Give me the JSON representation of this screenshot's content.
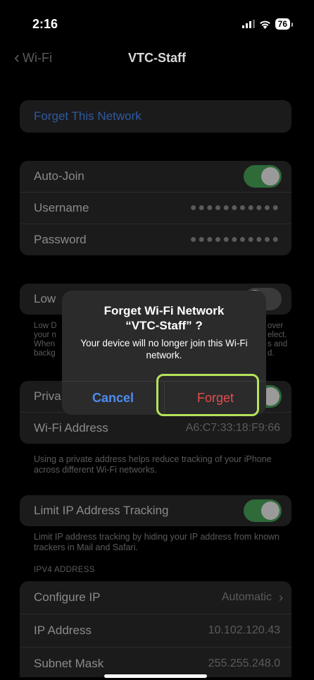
{
  "status": {
    "time": "2:16",
    "battery": "76"
  },
  "nav": {
    "back_label": "Wi-Fi",
    "title": "VTC-Staff"
  },
  "forget_row": "Forget This Network",
  "credentials": {
    "auto_join": "Auto-Join",
    "username_label": "Username",
    "username_value": "●●●●●●●●●●●",
    "password_label": "Password",
    "password_value": "●●●●●●●●●●●"
  },
  "low_data": {
    "label": "Low",
    "note_left": [
      "Low D",
      "your n",
      "When",
      "backg"
    ],
    "note_right": [
      "over",
      "elect.",
      "s and",
      "d."
    ]
  },
  "private": {
    "label": "Priva",
    "wifi_address_label": "Wi-Fi Address",
    "wifi_address_value": "A6:C7:33:18:F9:66",
    "note": "Using a private address helps reduce tracking of your iPhone across different Wi-Fi networks."
  },
  "limit_ip": {
    "label": "Limit IP Address Tracking",
    "note": "Limit IP address tracking by hiding your IP address from known trackers in Mail and Safari."
  },
  "ipv4": {
    "header": "IPV4 ADDRESS",
    "configure_label": "Configure IP",
    "configure_value": "Automatic",
    "ip_label": "IP Address",
    "ip_value": "10.102.120.43",
    "subnet_label": "Subnet Mask",
    "subnet_value": "255.255.248.0"
  },
  "alert": {
    "title_line1": "Forget Wi-Fi Network",
    "title_line2": "“VTC-Staff” ?",
    "message": "Your device will no longer join this Wi-Fi network.",
    "cancel": "Cancel",
    "forget": "Forget"
  },
  "colors": {
    "accent": "#4d8cf0",
    "destructive": "#e74c4c",
    "highlight": "#b5e35a",
    "toggle_on": "#2f6a39"
  }
}
